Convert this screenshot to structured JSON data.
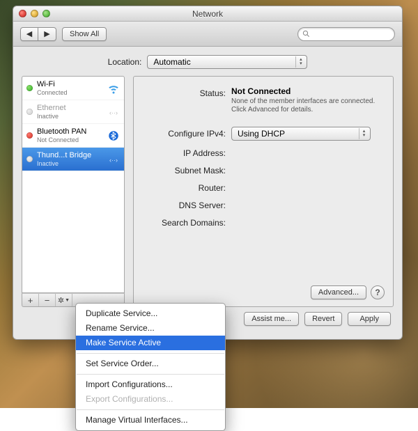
{
  "window": {
    "title": "Network"
  },
  "toolbar": {
    "show_all": "Show All",
    "search_placeholder": ""
  },
  "location": {
    "label": "Location:",
    "value": "Automatic"
  },
  "services": [
    {
      "name": "Wi-Fi",
      "status": "Connected",
      "dot": "green",
      "icon": "wifi"
    },
    {
      "name": "Ethernet",
      "status": "Inactive",
      "dot": "clear",
      "icon": "ethernet",
      "dimmed": true
    },
    {
      "name": "Bluetooth PAN",
      "status": "Not Connected",
      "dot": "red",
      "icon": "bluetooth"
    },
    {
      "name": "Thund...t Bridge",
      "status": "Inactive",
      "dot": "clear",
      "icon": "bridge",
      "selected": true
    }
  ],
  "actions": {
    "add": "+",
    "remove": "−",
    "gear": "✻▾"
  },
  "detail": {
    "status_label": "Status:",
    "status_value": "Not Connected",
    "status_note": "None of the member interfaces are connected. Click Advanced for details.",
    "configure_label": "Configure IPv4:",
    "configure_value": "Using DHCP",
    "ip_label": "IP Address:",
    "subnet_label": "Subnet Mask:",
    "router_label": "Router:",
    "dns_label": "DNS Server:",
    "search_label": "Search Domains:",
    "advanced": "Advanced...",
    "help": "?"
  },
  "buttons": {
    "assist": "Assist me...",
    "revert": "Revert",
    "apply": "Apply"
  },
  "context_menu": {
    "duplicate": "Duplicate Service...",
    "rename": "Rename Service...",
    "make_active": "Make Service Active",
    "order": "Set Service Order...",
    "import": "Import Configurations...",
    "export": "Export Configurations...",
    "manage": "Manage Virtual Interfaces..."
  }
}
